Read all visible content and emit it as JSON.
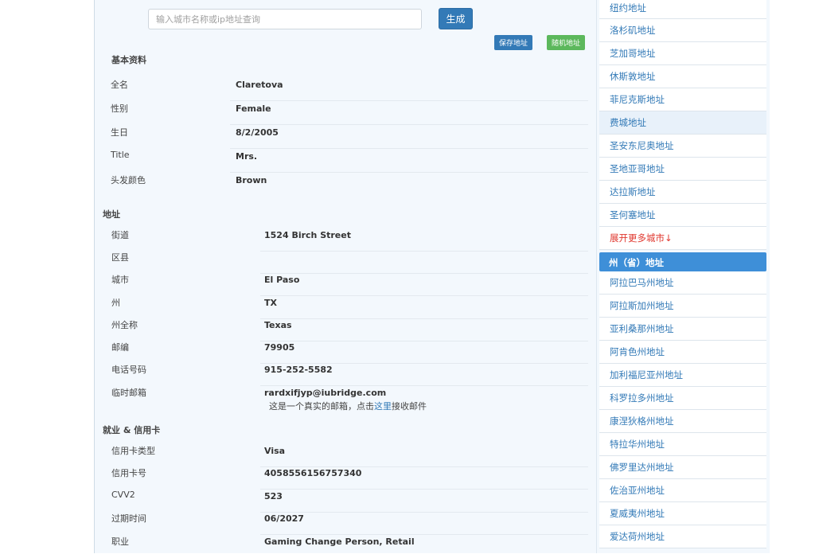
{
  "search": {
    "placeholder": "输入城市名称或ip地址查询",
    "button": "生成"
  },
  "actions": {
    "save": "保存地址",
    "random": "随机地址"
  },
  "basic": {
    "title": "基本资料",
    "rows": [
      {
        "label": "全名",
        "value": "Claretova"
      },
      {
        "label": "性别",
        "value": "Female"
      },
      {
        "label": "生日",
        "value": "8/2/2005"
      },
      {
        "label": "Title",
        "value": "Mrs."
      },
      {
        "label": "头发颜色",
        "value": "Brown"
      }
    ]
  },
  "address": {
    "title": "地址",
    "rows": [
      {
        "label": "街道",
        "value": "1524  Birch  Street"
      },
      {
        "label": "区县",
        "value": ""
      },
      {
        "label": "城市",
        "value": "El Paso"
      },
      {
        "label": "州",
        "value": "TX"
      },
      {
        "label": "州全称",
        "value": "Texas"
      },
      {
        "label": "邮编",
        "value": "79905"
      },
      {
        "label": "电话号码",
        "value": "915-252-5582"
      },
      {
        "label": "临时邮箱",
        "value": "rardxifjyp@iubridge.com"
      }
    ],
    "mail_note_prefix": "这是一个真实的邮箱，点击",
    "mail_note_link": "这里",
    "mail_note_suffix": "接收邮件"
  },
  "job": {
    "title": "就业 & 信用卡",
    "rows": [
      {
        "label": "信用卡类型",
        "value": "Visa"
      },
      {
        "label": "信用卡号",
        "value": "4058556156757340"
      },
      {
        "label": "CVV2",
        "value": "523"
      },
      {
        "label": "过期时间",
        "value": "06/2027"
      },
      {
        "label": "职业",
        "value": "Gaming Change Person, Retail"
      }
    ]
  },
  "cities": [
    "纽约地址",
    "洛杉矶地址",
    "芝加哥地址",
    "休斯敦地址",
    "菲尼克斯地址",
    "费城地址",
    "圣安东尼奥地址",
    "圣地亚哥地址",
    "达拉斯地址",
    "圣何塞地址"
  ],
  "cities_more": "展开更多城市↓",
  "states_title": "州（省）地址",
  "states": [
    "阿拉巴马州地址",
    "阿拉斯加州地址",
    "亚利桑那州地址",
    "阿肯色州地址",
    "加利福尼亚州地址",
    "科罗拉多州地址",
    "康涅狄格州地址",
    "特拉华州地址",
    "佛罗里达州地址",
    "佐治亚州地址",
    "夏威夷州地址",
    "爱达荷州地址"
  ],
  "colors": {
    "primary": "#337ab7",
    "success": "#5cb85c",
    "header": "#3e8fd8",
    "more_link": "#e0372e"
  }
}
